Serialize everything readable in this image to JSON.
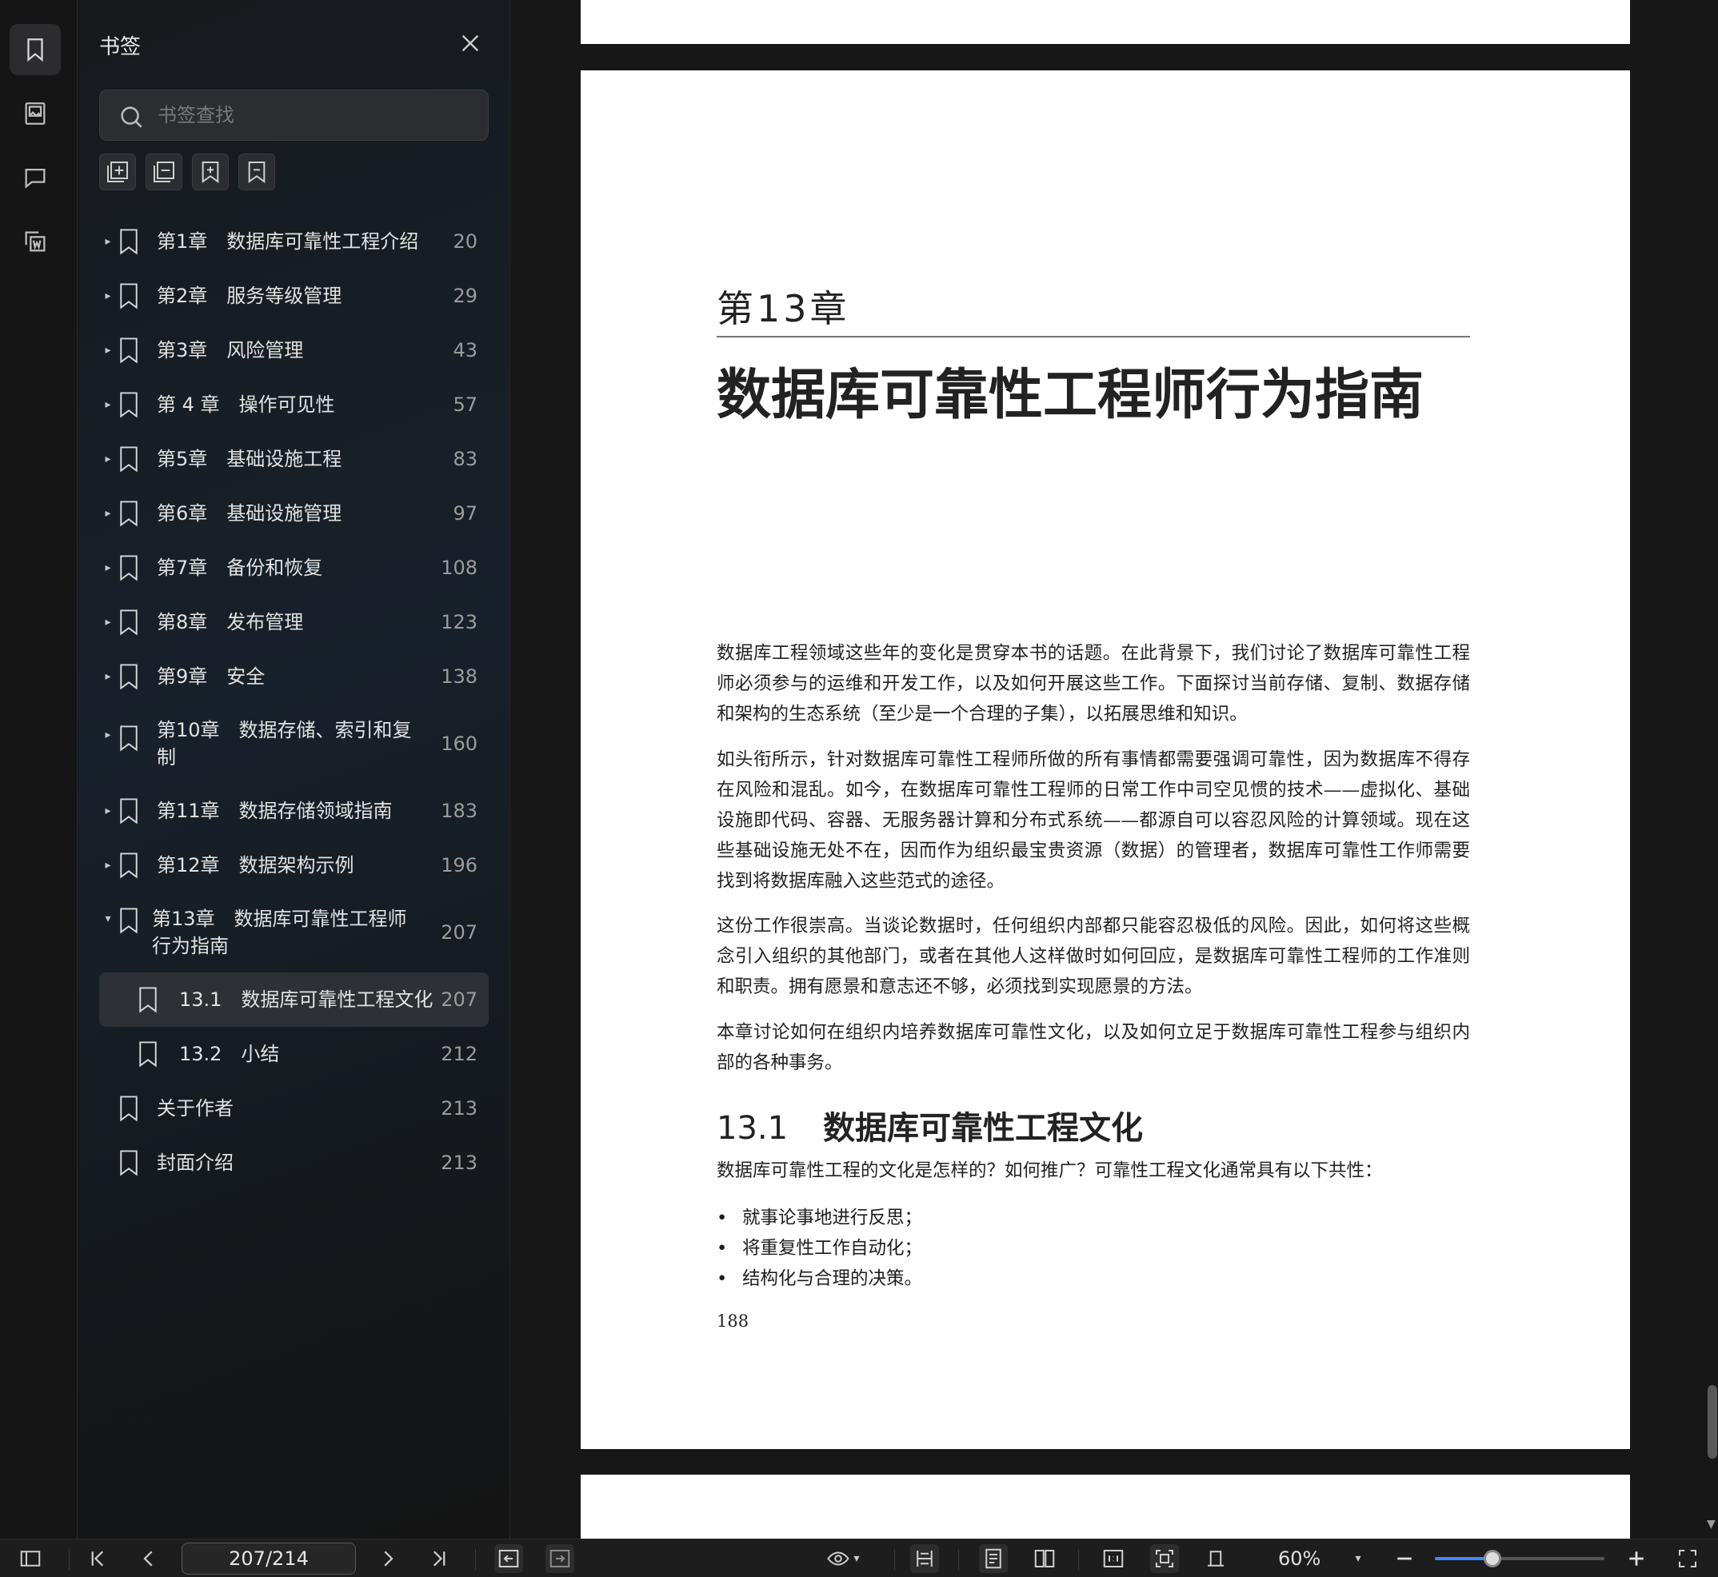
{
  "sidebar": {
    "title": "书签",
    "search_placeholder": "书签查找",
    "bookmarks": [
      {
        "label": "第1章　数据库可靠性工程介绍",
        "page": "20"
      },
      {
        "label": "第2章　服务等级管理",
        "page": "29"
      },
      {
        "label": "第3章　风险管理",
        "page": "43"
      },
      {
        "label": "第 4 章　操作可见性",
        "page": "57"
      },
      {
        "label": "第5章　基础设施工程",
        "page": "83"
      },
      {
        "label": "第6章　基础设施管理",
        "page": "97"
      },
      {
        "label": "第7章　备份和恢复",
        "page": "108"
      },
      {
        "label": "第8章　发布管理",
        "page": "123"
      },
      {
        "label": "第9章　安全",
        "page": "138"
      },
      {
        "label": "第10章　数据存储、索引和复制",
        "page": "160"
      },
      {
        "label": "第11章　数据存储领域指南",
        "page": "183"
      },
      {
        "label": "第12章　数据架构示例",
        "page": "196"
      },
      {
        "label": "第13章　数据库可靠性工程师行为指南",
        "page": "207"
      },
      {
        "label": "13.1　数据库可靠性工程文化",
        "page": "207"
      },
      {
        "label": "13.2　小结",
        "page": "212"
      },
      {
        "label": "关于作者",
        "page": "213"
      },
      {
        "label": "封面介绍",
        "page": "213"
      }
    ]
  },
  "document": {
    "chapter_number": "第13章",
    "chapter_title": "数据库可靠性工程师行为指南",
    "paragraphs": [
      "数据库工程领域这些年的变化是贯穿本书的话题。在此背景下，我们讨论了数据库可靠性工程师必须参与的运维和开发工作，以及如何开展这些工作。下面探讨当前存储、复制、数据存储和架构的生态系统（至少是一个合理的子集），以拓展思维和知识。",
      "如头衔所示，针对数据库可靠性工程师所做的所有事情都需要强调可靠性，因为数据库不得存在风险和混乱。如今，在数据库可靠性工程师的日常工作中司空见惯的技术——虚拟化、基础设施即代码、容器、无服务器计算和分布式系统——都源自可以容忍风险的计算领域。现在这些基础设施无处不在，因而作为组织最宝贵资源（数据）的管理者，数据库可靠性工作师需要找到将数据库融入这些范式的途径。",
      "这份工作很崇高。当谈论数据时，任何组织内部都只能容忍极低的风险。因此，如何将这些概念引入组织的其他部门，或者在其他人这样做时如何回应，是数据库可靠性工程师的工作准则和职责。拥有愿景和意志还不够，必须找到实现愿景的方法。",
      "本章讨论如何在组织内培养数据库可靠性文化，以及如何立足于数据库可靠性工程参与组织内部的各种事务。"
    ],
    "section_number": "13.1",
    "section_title": "数据库可靠性工程文化",
    "section_intro": "数据库可靠性工程的文化是怎样的？如何推广？可靠性工程文化通常具有以下共性：",
    "bullets": [
      "就事论事地进行反思；",
      "将重复性工作自动化；",
      "结构化与合理的决策。"
    ],
    "page_number": "188"
  },
  "toolbar": {
    "page_indicator": "207/214",
    "zoom": "60%",
    "zoom_fraction": 0.34
  },
  "colors": {
    "accent": "#3d8bfd",
    "panel_bg": "#17212b",
    "selected_bg": "#2d3034"
  }
}
